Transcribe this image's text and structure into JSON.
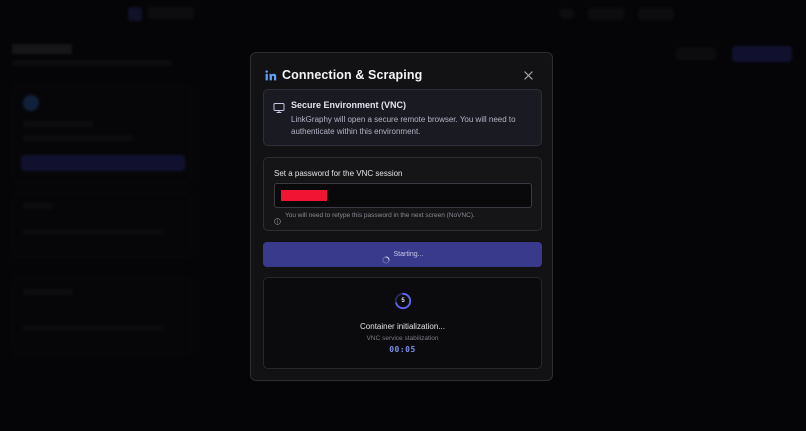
{
  "modal": {
    "title": "Connection & Scraping",
    "vnc": {
      "title": "Secure Environment (VNC)",
      "description": "LinkGraphy will open a secure remote browser. You will need to authenticate within this environment."
    },
    "password": {
      "label": "Set a password for the VNC session",
      "hint": "You will need to retype this password in the next screen (NoVNC)."
    },
    "start_button": "Starting...",
    "status": {
      "countdown": "5",
      "title": "Container initialization...",
      "subtitle": "VNC service stabilization",
      "timer": "00:05"
    }
  },
  "icons": {
    "brand": "linkedin-icon",
    "close": "close-icon",
    "vnc": "monitor-icon",
    "hint": "info-icon",
    "loading": "spinner-icon"
  },
  "colors": {
    "accent": "#3a3a8c",
    "timer": "#7b8ce8",
    "password_mask": "#f21433",
    "background": "#050507"
  }
}
